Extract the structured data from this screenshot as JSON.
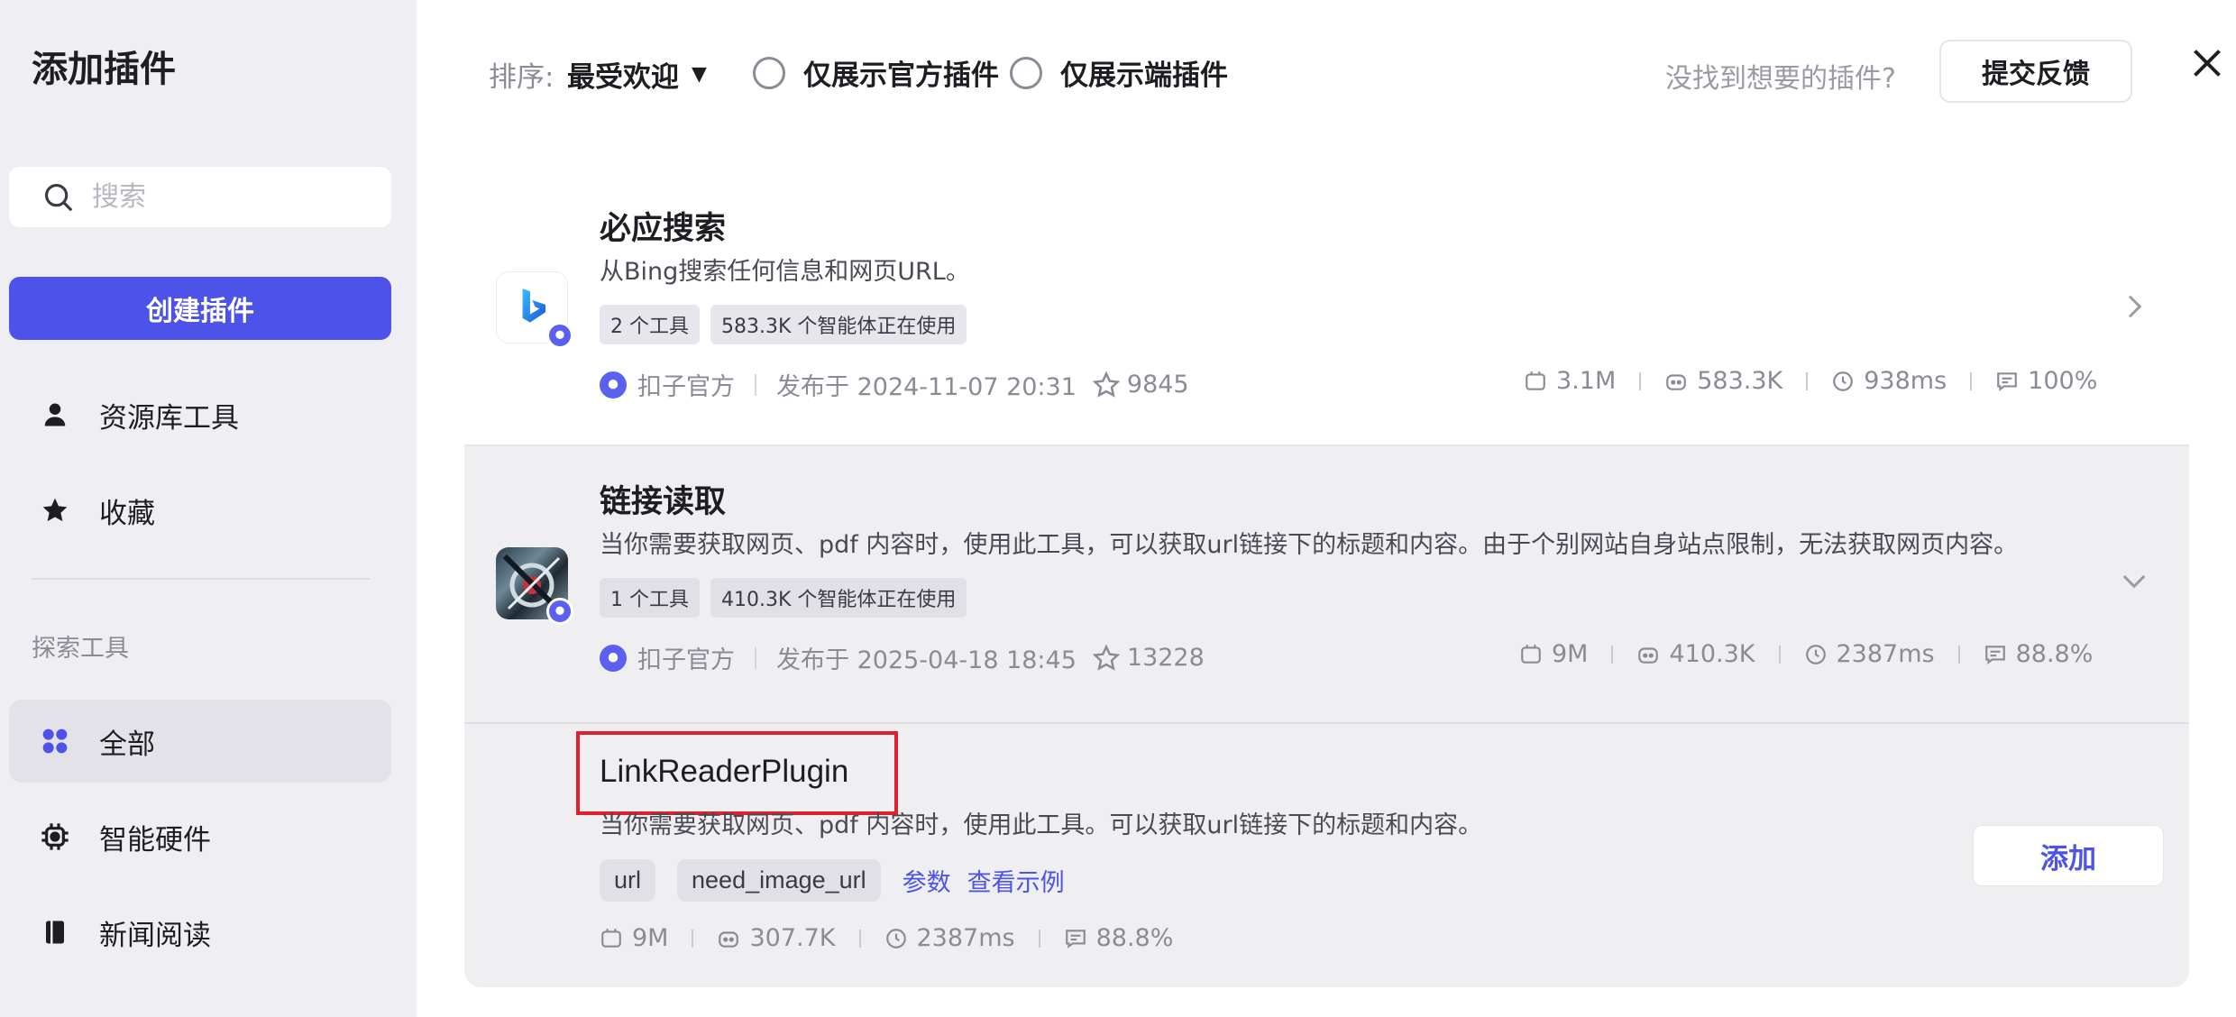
{
  "sidebar": {
    "title": "添加插件",
    "search_placeholder": "搜索",
    "create_label": "创建插件",
    "items": [
      {
        "label": "资源库工具",
        "icon": "user-icon"
      },
      {
        "label": "收藏",
        "icon": "star-icon"
      }
    ],
    "section_label": "探索工具",
    "explore_items": [
      {
        "label": "全部",
        "icon": "grid-icon",
        "active": true
      },
      {
        "label": "智能硬件",
        "icon": "chip-icon"
      },
      {
        "label": "新闻阅读",
        "icon": "book-icon"
      }
    ]
  },
  "topbar": {
    "sort_label": "排序:",
    "sort_value": "最受欢迎",
    "filter_official": "仅展示官方插件",
    "filter_device": "仅展示端插件",
    "hint": "没找到想要的插件?",
    "feedback_label": "提交反馈"
  },
  "plugins": [
    {
      "title": "必应搜索",
      "description": "从Bing搜索任何信息和网页URL。",
      "tags": [
        "2 个工具",
        "583.3K 个智能体正在使用"
      ],
      "publisher": "扣子官方",
      "published": "发布于 2024-11-07 20:31",
      "stars": "9845",
      "stats": [
        "3.1M",
        "583.3K",
        "938ms",
        "100%"
      ]
    },
    {
      "title": "链接读取",
      "description": "当你需要获取网页、pdf 内容时，使用此工具，可以获取url链接下的标题和内容。由于个别网站自身站点限制，无法获取网页内容。",
      "tags": [
        "1 个工具",
        "410.3K 个智能体正在使用"
      ],
      "publisher": "扣子官方",
      "published": "发布于 2025-04-18 18:45",
      "stars": "13228",
      "stats": [
        "9M",
        "410.3K",
        "2387ms",
        "88.8%"
      ]
    }
  ],
  "tool": {
    "title": "LinkReaderPlugin",
    "description": "当你需要获取网页、pdf 内容时，使用此工具。可以获取url链接下的标题和内容。",
    "params": [
      "url",
      "need_image_url"
    ],
    "params_link": "参数",
    "example_link": "查看示例",
    "stats": [
      "9M",
      "307.7K",
      "2387ms",
      "88.8%"
    ],
    "add_label": "添加"
  },
  "colors": {
    "accent": "#4d53e8",
    "highlight_box": "#e0202a",
    "sidebar_bg": "#efeff3"
  }
}
